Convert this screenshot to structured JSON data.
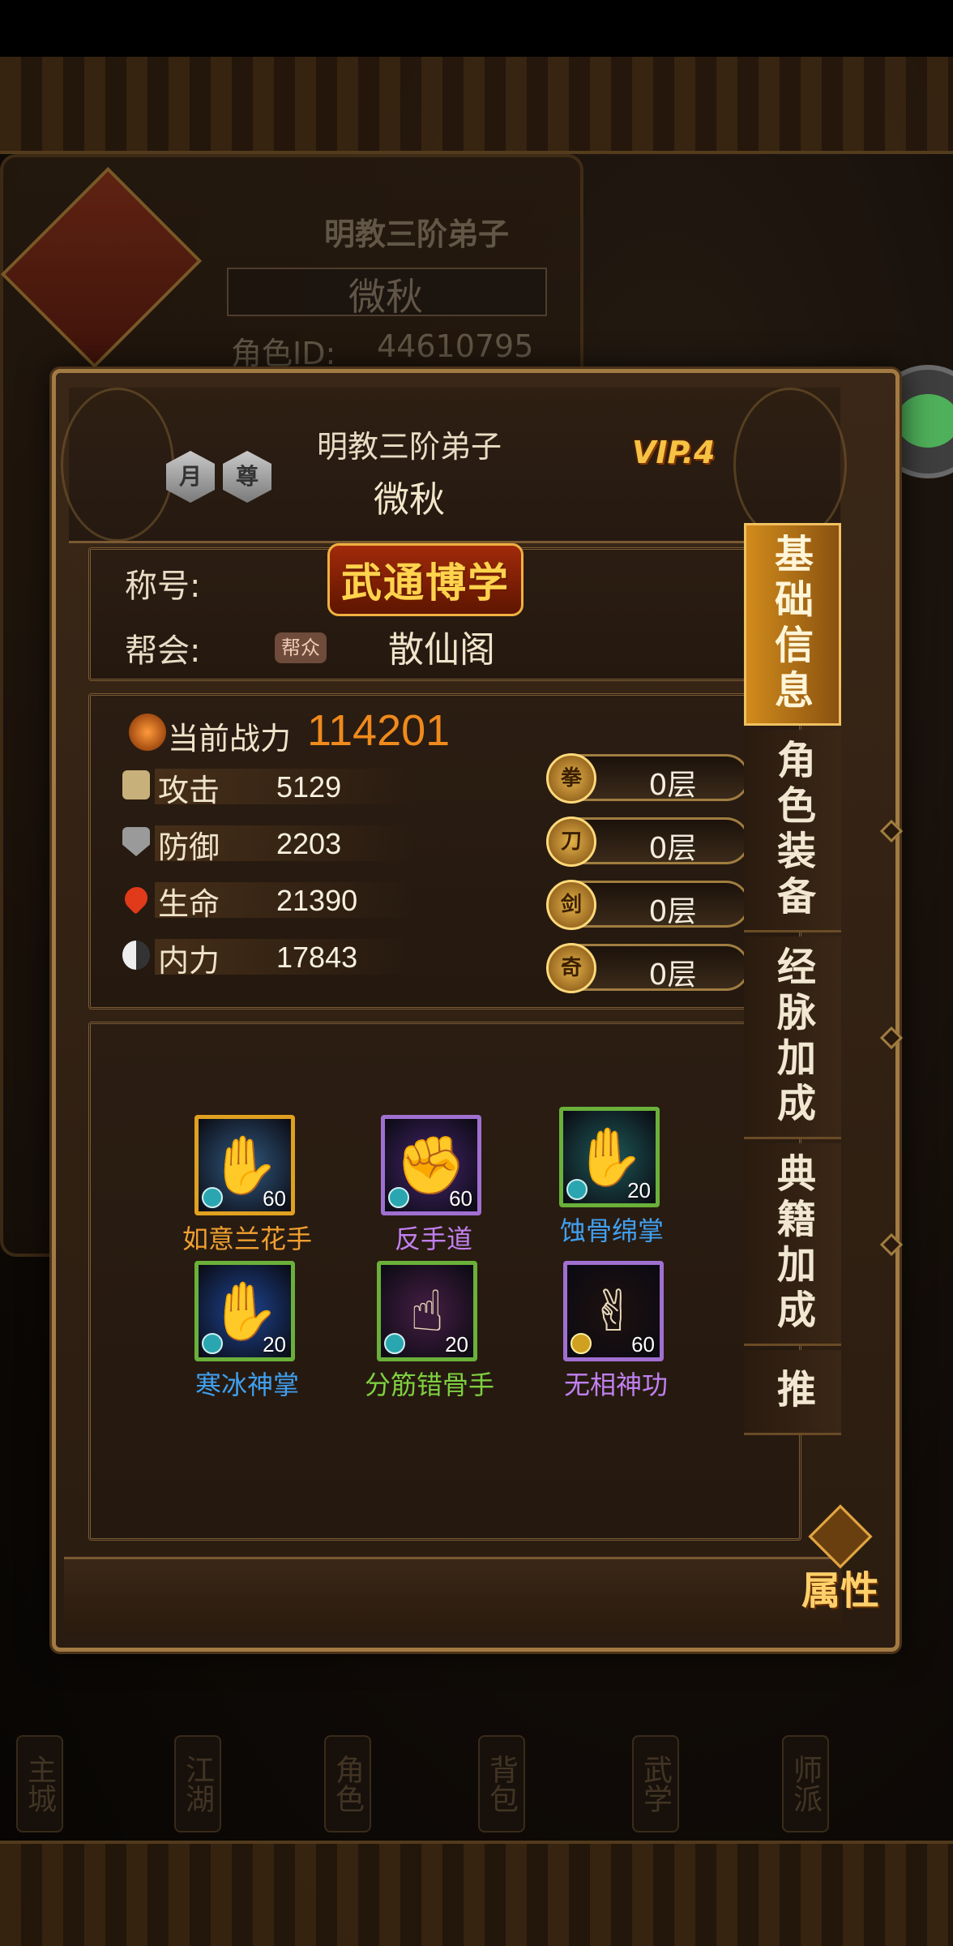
{
  "background": {
    "profile_title": "明教三阶弟子",
    "profile_name": "微秋",
    "role_id_label": "角色ID:",
    "role_id_value": "44610795",
    "nav": [
      "主城",
      "江湖",
      "角色",
      "背包",
      "武学",
      "师派"
    ]
  },
  "header": {
    "rank_badges": [
      "月",
      "尊"
    ],
    "sect_title": "明教三阶弟子",
    "player_name": "微秋",
    "vip": "VIP.4"
  },
  "info": {
    "title_label": "称号:",
    "title_value": "武通博学",
    "guild_label": "帮会:",
    "guild_role": "帮众",
    "guild_name": "散仙阁"
  },
  "power": {
    "label": "当前战力",
    "value": "114201"
  },
  "stats": [
    {
      "name": "攻击",
      "value": "5129",
      "icon": "sword-icon",
      "color": "#c8b07a"
    },
    {
      "name": "防御",
      "value": "2203",
      "icon": "shield-icon",
      "color": "#9a9a9a"
    },
    {
      "name": "生命",
      "value": "21390",
      "icon": "heart-icon",
      "color": "#e03a1a"
    },
    {
      "name": "内力",
      "value": "17843",
      "icon": "yinyang-icon",
      "color": "#d8d8d8"
    }
  ],
  "layers": [
    {
      "coin": "拳",
      "text": "0层"
    },
    {
      "coin": "刀",
      "text": "0层"
    },
    {
      "coin": "剑",
      "text": "0层"
    },
    {
      "coin": "奇",
      "text": "0层"
    }
  ],
  "skills": [
    {
      "name": "如意兰花手",
      "level": "60",
      "border": "#e0a020",
      "name_color": "#f0a030",
      "bg": "#2a4a6a",
      "glyph": "✋",
      "gem": "teal"
    },
    {
      "name": "反手道",
      "level": "60",
      "border": "#a070d0",
      "name_color": "#c080f0",
      "bg": "#3a1f5a",
      "glyph": "✊",
      "gem": "teal"
    },
    {
      "name": "蚀骨绵掌",
      "level": "20",
      "border": "#6ab03a",
      "name_color": "#40a0f0",
      "bg": "#1a4a4a",
      "glyph": "✋",
      "gem": "teal"
    },
    {
      "name": "寒冰神掌",
      "level": "20",
      "border": "#6ab03a",
      "name_color": "#40a0f0",
      "bg": "#1a3a7a",
      "glyph": "✋",
      "gem": "teal"
    },
    {
      "name": "分筋错骨手",
      "level": "20",
      "border": "#6ab03a",
      "name_color": "#7ed040",
      "bg": "#3a1a3a",
      "glyph": "☝",
      "gem": "teal"
    },
    {
      "name": "无相神功",
      "level": "60",
      "border": "#a070d0",
      "name_color": "#c080f0",
      "bg": "#1a1010",
      "glyph": "✌",
      "gem": "gold"
    }
  ],
  "tabs": [
    {
      "label": "基础信息",
      "active": true
    },
    {
      "label": "角色装备",
      "active": false
    },
    {
      "label": "经脉加成",
      "active": false
    },
    {
      "label": "典籍加成",
      "active": false
    },
    {
      "label": "推图",
      "active": false
    }
  ],
  "attr_button": "属性",
  "colors": {
    "accent": "#f08a1c",
    "gold": "#ffd06a",
    "panel_border": "#a27a43"
  }
}
